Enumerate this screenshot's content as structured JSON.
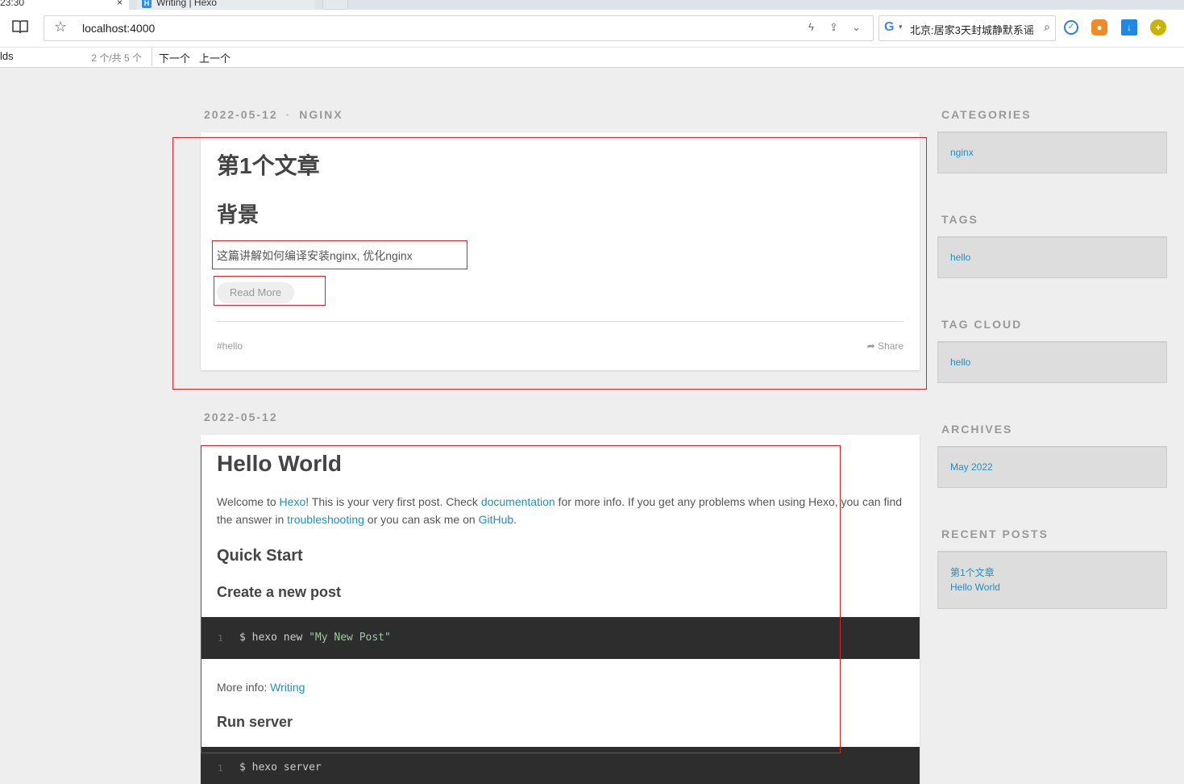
{
  "browser": {
    "tabs": [
      {
        "label": "23:30",
        "close": "×"
      },
      {
        "label": "Writing | Hexo"
      }
    ],
    "address": "localhost:4000",
    "search_text": "北京:居家3天封城静默系谣",
    "find": {
      "query": "lds",
      "count": "2 个/共 5 个",
      "next": "下一个",
      "prev": "上一个"
    }
  },
  "posts": [
    {
      "date": "2022-05-12",
      "category": "NGINX",
      "title": "第1个文章",
      "heading": "背景",
      "excerpt": "这篇讲解如何编译安装nginx, 优化nginx",
      "read_more": "Read More",
      "tag": "#hello",
      "share": "Share"
    },
    {
      "date": "2022-05-12",
      "title": "Hello World",
      "intro": {
        "t1": "Welcome to ",
        "l1": "Hexo",
        "t2": "! This is your very first post. Check ",
        "l2": "documentation",
        "t3": " for more info. If you get any problems when using Hexo, you can find the answer in ",
        "l3": "troubleshooting",
        "t4": " or you can ask me on ",
        "l4": "GitHub",
        "t5": "."
      },
      "h_quick_start": "Quick Start",
      "h_create": "Create a new post",
      "code1": {
        "line": "1",
        "cmd": "$ hexo new ",
        "arg": "\"My New Post\""
      },
      "more_info": "More info: ",
      "more_link": "Writing",
      "h_run": "Run server",
      "code2": {
        "line": "1",
        "cmd": "$ hexo server"
      }
    }
  ],
  "sidebar": {
    "categories": {
      "title": "CATEGORIES",
      "items": [
        "nginx"
      ]
    },
    "tags": {
      "title": "TAGS",
      "items": [
        "hello"
      ]
    },
    "tag_cloud": {
      "title": "TAG CLOUD",
      "items": [
        "hello"
      ]
    },
    "archives": {
      "title": "ARCHIVES",
      "items": [
        "May 2022"
      ]
    },
    "recent": {
      "title": "RECENT POSTS",
      "items": [
        "第1个文章",
        "Hello World"
      ]
    }
  },
  "colors": {
    "link": "#258fb8",
    "annotation": "#d9232b",
    "code_bg": "#2d2d2d"
  },
  "icons": [
    "reader-icon",
    "star-icon",
    "flash-icon",
    "share-icon",
    "chevron-down-icon",
    "google-icon",
    "search-icon",
    "share-arrow-icon"
  ]
}
